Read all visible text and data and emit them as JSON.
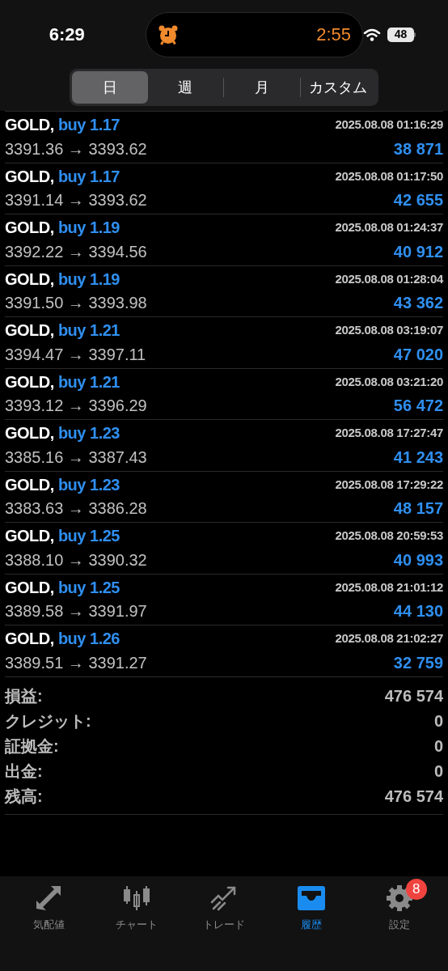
{
  "status_bar": {
    "time": "6:29",
    "timer": "2:55",
    "battery": "48"
  },
  "tabs": [
    {
      "label": "日",
      "selected": true
    },
    {
      "label": "週",
      "selected": false
    },
    {
      "label": "月",
      "selected": false
    },
    {
      "label": "カスタム",
      "selected": false
    }
  ],
  "deals": [
    {
      "symbol": "GOLD,",
      "side": "buy 1.17",
      "time": "2025.08.08 01:16:29",
      "prices": "3391.36 → 3393.62",
      "profit": "38 871"
    },
    {
      "symbol": "GOLD,",
      "side": "buy 1.17",
      "time": "2025.08.08 01:17:50",
      "prices": "3391.14 → 3393.62",
      "profit": "42 655"
    },
    {
      "symbol": "GOLD,",
      "side": "buy 1.19",
      "time": "2025.08.08 01:24:37",
      "prices": "3392.22 → 3394.56",
      "profit": "40 912"
    },
    {
      "symbol": "GOLD,",
      "side": "buy 1.19",
      "time": "2025.08.08 01:28:04",
      "prices": "3391.50 → 3393.98",
      "profit": "43 362"
    },
    {
      "symbol": "GOLD,",
      "side": "buy 1.21",
      "time": "2025.08.08 03:19:07",
      "prices": "3394.47 → 3397.11",
      "profit": "47 020"
    },
    {
      "symbol": "GOLD,",
      "side": "buy 1.21",
      "time": "2025.08.08 03:21:20",
      "prices": "3393.12 → 3396.29",
      "profit": "56 472"
    },
    {
      "symbol": "GOLD,",
      "side": "buy 1.23",
      "time": "2025.08.08 17:27:47",
      "prices": "3385.16 → 3387.43",
      "profit": "41 243"
    },
    {
      "symbol": "GOLD,",
      "side": "buy 1.23",
      "time": "2025.08.08 17:29:22",
      "prices": "3383.63 → 3386.28",
      "profit": "48 157"
    },
    {
      "symbol": "GOLD,",
      "side": "buy 1.25",
      "time": "2025.08.08 20:59:53",
      "prices": "3388.10 → 3390.32",
      "profit": "40 993"
    },
    {
      "symbol": "GOLD,",
      "side": "buy 1.25",
      "time": "2025.08.08 21:01:12",
      "prices": "3389.58 → 3391.97",
      "profit": "44 130"
    },
    {
      "symbol": "GOLD,",
      "side": "buy 1.26",
      "time": "2025.08.08 21:02:27",
      "prices": "3389.51 → 3391.27",
      "profit": "32 759"
    }
  ],
  "summary": [
    {
      "label": "損益:",
      "value": "476 574"
    },
    {
      "label": "クレジット:",
      "value": "0"
    },
    {
      "label": "証拠金:",
      "value": "0"
    },
    {
      "label": "出金:",
      "value": "0"
    },
    {
      "label": "残高:",
      "value": "476 574"
    }
  ],
  "nav": [
    {
      "kind": "quotes",
      "label": "気配値",
      "selected": false
    },
    {
      "kind": "chart",
      "label": "チャート",
      "selected": false
    },
    {
      "kind": "trade",
      "label": "トレード",
      "selected": false
    },
    {
      "kind": "history",
      "label": "履歴",
      "selected": true
    },
    {
      "kind": "settings",
      "label": "設定",
      "selected": false,
      "badge": "8"
    }
  ]
}
